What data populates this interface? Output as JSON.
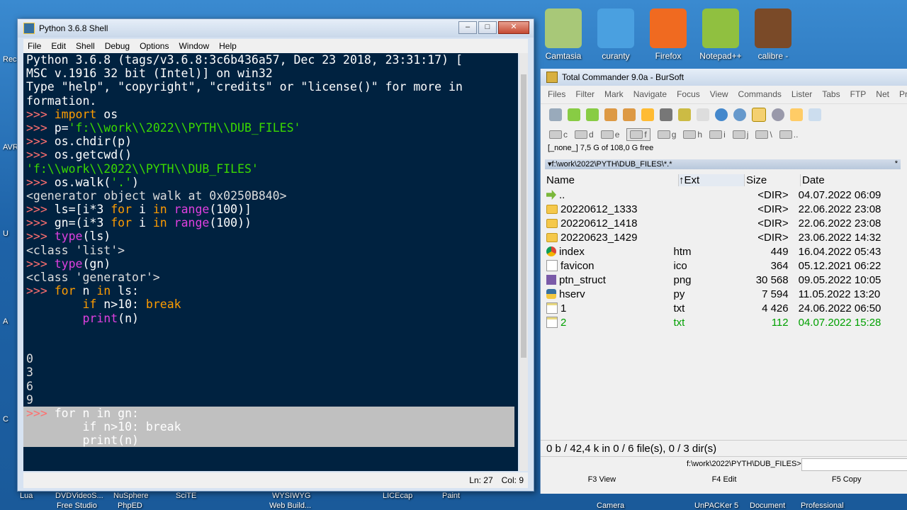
{
  "desktop": {
    "top_icons": [
      {
        "label": "Camtasia",
        "color": "#a8c878"
      },
      {
        "label": "curanty",
        "color": "#4aa0e0"
      },
      {
        "label": "Firefox",
        "color": "#f06a20"
      },
      {
        "label": "Notepad++",
        "color": "#90c040"
      },
      {
        "label": "calibre -",
        "color": "#7a4a28"
      }
    ],
    "left_edge_labels": [
      "Rec",
      "AVR",
      "U",
      "A",
      "C"
    ],
    "bottom_labels": [
      "Lua",
      "DVDVideoS...",
      "Free Studio",
      "NuSphere",
      "PhpED",
      "SciTE",
      "WYSIWYG",
      "Web Build...",
      "LICEcap",
      "Paint",
      "Camera",
      "UnPACKer 5",
      "Document",
      "Professional"
    ]
  },
  "python_shell": {
    "title": "Python 3.6.8 Shell",
    "window_buttons": [
      "‒",
      "□",
      "✕"
    ],
    "menu": [
      "File",
      "Edit",
      "Shell",
      "Debug",
      "Options",
      "Window",
      "Help"
    ],
    "code_lines": [
      "Python 3.6.8 (tags/v3.6.8:3c6b436a57, Dec 23 2018, 23:31:17) [",
      "MSC v.1916 32 bit (Intel)] on win32",
      "Type \"help\", \"copyright\", \"credits\" or \"license()\" for more in",
      "formation.",
      ">>> import os",
      ">>> p='f:\\\\work\\\\2022\\\\PYTH\\\\DUB_FILES'",
      ">>> os.chdir(p)",
      ">>> os.getcwd()",
      "'f:\\\\work\\\\2022\\\\PYTH\\\\DUB_FILES'",
      ">>> os.walk('.')",
      "<generator object walk at 0x0250B840>",
      ">>> ls=[i*3 for i in range(100)]",
      ">>> gn=(i*3 for i in range(100))",
      ">>> type(ls)",
      "<class 'list'>",
      ">>> type(gn)",
      "<class 'generator'>",
      ">>> for n in ls:",
      "        if n>10: break",
      "        print(n)",
      "",
      "",
      "0",
      "3",
      "6",
      "9",
      ">>> for n in gn:",
      "        if n>10: break",
      "        print(n)"
    ],
    "status": {
      "line": "Ln: 27",
      "col": "Col: 9"
    }
  },
  "total_commander": {
    "title": "Total Commander 9.0a - BurSoft",
    "menu": [
      "Files",
      "Filter",
      "Mark",
      "Navigate",
      "Focus",
      "View",
      "Commands",
      "Lister",
      "Tabs",
      "FTP",
      "Net",
      "Pre"
    ],
    "drives": [
      "c",
      "d",
      "e",
      "f",
      "g",
      "h",
      "i",
      "j",
      "\\",
      ".."
    ],
    "active_drive": "f",
    "drive_free": "[_none_]  7,5 G of 108,0 G free",
    "path": "▾f:\\work\\2022\\PYTH\\DUB_FILES\\*.*",
    "path_star": "*",
    "columns": {
      "name": "Name",
      "ext": "↑Ext",
      "size": "Size",
      "date": "Date"
    },
    "files": [
      {
        "name": "..",
        "ext": "",
        "size": "<DIR>",
        "date": "04.07.2022 06:09",
        "icon": "up"
      },
      {
        "name": "20220612_1333",
        "ext": "",
        "size": "<DIR>",
        "date": "22.06.2022 23:08",
        "icon": "folder"
      },
      {
        "name": "20220612_1418",
        "ext": "",
        "size": "<DIR>",
        "date": "22.06.2022 23:08",
        "icon": "folder"
      },
      {
        "name": "20220623_1429",
        "ext": "",
        "size": "<DIR>",
        "date": "23.06.2022 14:32",
        "icon": "folder"
      },
      {
        "name": "index",
        "ext": "htm",
        "size": "449",
        "date": "16.04.2022 05:43",
        "icon": "chrome"
      },
      {
        "name": "favicon",
        "ext": "ico",
        "size": "364",
        "date": "05.12.2021 06:22",
        "icon": "doc"
      },
      {
        "name": "ptn_struct",
        "ext": "png",
        "size": "30 568",
        "date": "09.05.2022 10:05",
        "icon": "png"
      },
      {
        "name": "hserv",
        "ext": "py",
        "size": "7 594",
        "date": "11.05.2022 13:20",
        "icon": "py"
      },
      {
        "name": "1",
        "ext": "txt",
        "size": "4 426",
        "date": "24.06.2022 06:50",
        "icon": "txt"
      },
      {
        "name": "2",
        "ext": "txt",
        "size": "112",
        "date": "04.07.2022 15:28",
        "icon": "txt"
      }
    ],
    "status": "0 b / 42,4 k in 0 / 6 file(s), 0 / 3 dir(s)",
    "cmd_path": "f:\\work\\2022\\PYTH\\DUB_FILES>",
    "fkeys": [
      "F3 View",
      "F4 Edit",
      "F5 Copy"
    ]
  }
}
